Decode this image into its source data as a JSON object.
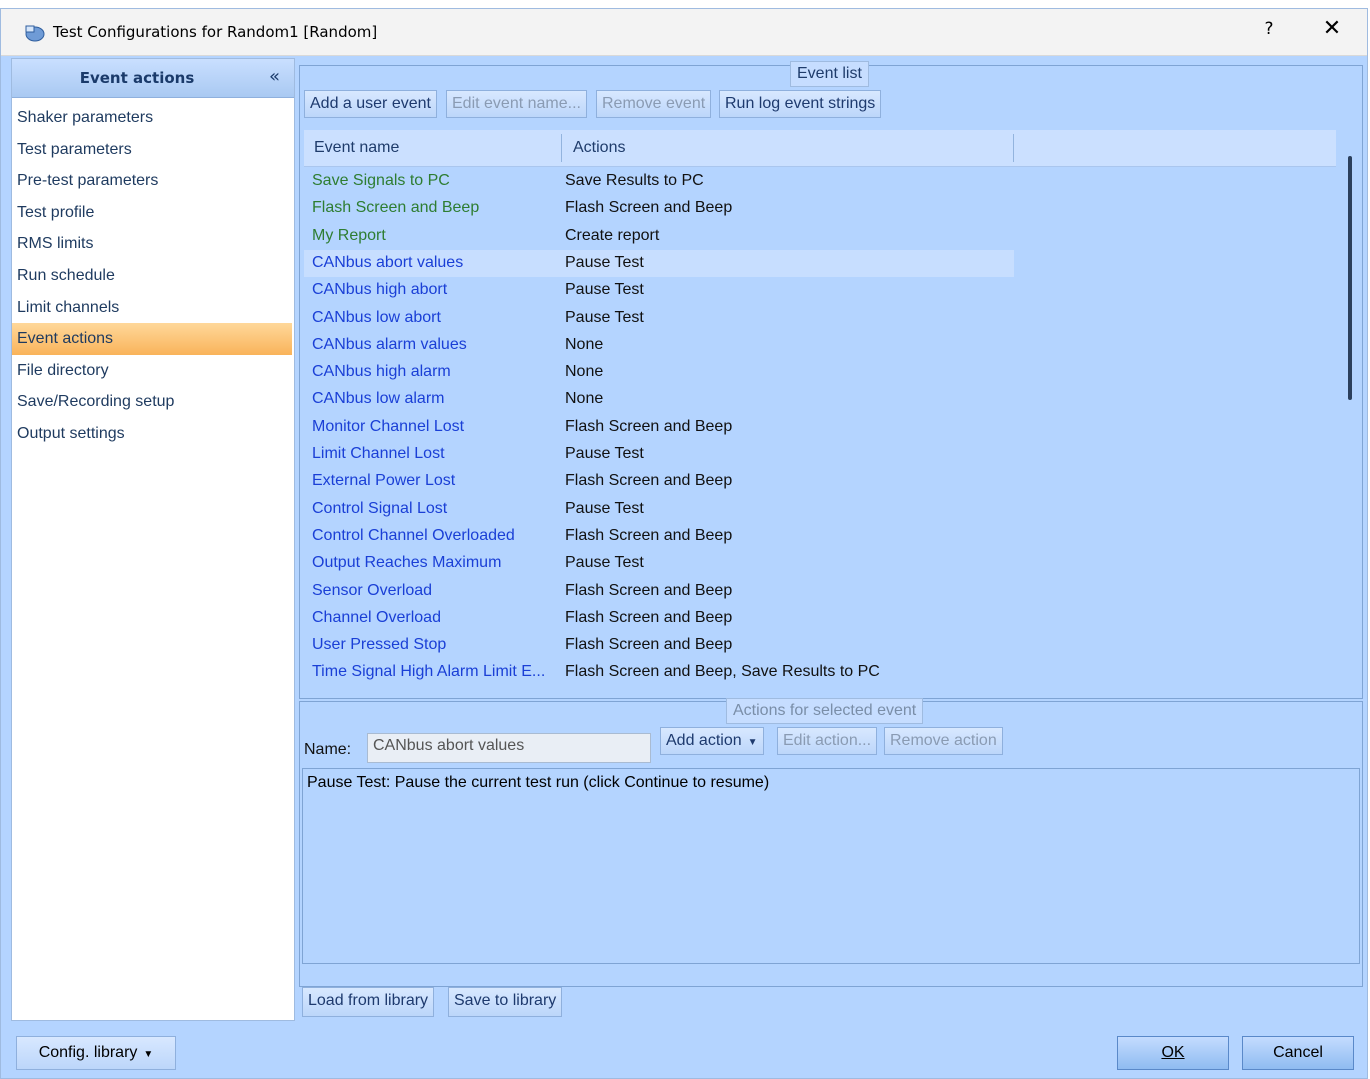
{
  "window": {
    "title": "Test Configurations for Random1 [Random]",
    "help_label": "?",
    "close_label": "✕"
  },
  "nav": {
    "header": "Event actions",
    "collapse_label": "«",
    "items": [
      {
        "label": "Shaker parameters"
      },
      {
        "label": "Test parameters"
      },
      {
        "label": "Pre-test parameters"
      },
      {
        "label": "Test profile"
      },
      {
        "label": "RMS limits"
      },
      {
        "label": "Run schedule"
      },
      {
        "label": "Limit channels"
      },
      {
        "label": "Event actions",
        "active": true
      },
      {
        "label": "File directory"
      },
      {
        "label": "Save/Recording setup"
      },
      {
        "label": "Output settings"
      }
    ]
  },
  "event_list": {
    "caption": "Event list",
    "buttons": {
      "add": "Add a user event",
      "edit": "Edit event name...",
      "remove": "Remove event",
      "run_log": "Run log event strings"
    },
    "columns": {
      "name": "Event name",
      "actions": "Actions"
    },
    "rows": [
      {
        "name": "Save Signals to PC",
        "action": "Save Results to PC",
        "kind": "user"
      },
      {
        "name": "Flash Screen and Beep",
        "action": "Flash Screen and Beep",
        "kind": "user"
      },
      {
        "name": "My Report",
        "action": "Create report",
        "kind": "user"
      },
      {
        "name": "CANbus abort values",
        "action": "Pause Test",
        "kind": "system",
        "selected": true
      },
      {
        "name": "CANbus high abort",
        "action": "Pause Test",
        "kind": "system"
      },
      {
        "name": "CANbus low abort",
        "action": "Pause Test",
        "kind": "system"
      },
      {
        "name": "CANbus alarm values",
        "action": "None",
        "kind": "system"
      },
      {
        "name": "CANbus high alarm",
        "action": "None",
        "kind": "system"
      },
      {
        "name": "CANbus low alarm",
        "action": "None",
        "kind": "system"
      },
      {
        "name": "Monitor Channel Lost",
        "action": "Flash Screen and Beep",
        "kind": "system"
      },
      {
        "name": "Limit Channel Lost",
        "action": "Pause Test",
        "kind": "system"
      },
      {
        "name": "External Power Lost",
        "action": "Flash Screen and Beep",
        "kind": "system"
      },
      {
        "name": "Control Signal Lost",
        "action": "Pause Test",
        "kind": "system"
      },
      {
        "name": "Control Channel Overloaded",
        "action": "Flash Screen and Beep",
        "kind": "system"
      },
      {
        "name": "Output Reaches Maximum",
        "action": "Pause Test",
        "kind": "system"
      },
      {
        "name": "Sensor Overload",
        "action": "Flash Screen and Beep",
        "kind": "system"
      },
      {
        "name": "Channel Overload",
        "action": "Flash Screen and Beep",
        "kind": "system"
      },
      {
        "name": "User Pressed Stop",
        "action": "Flash Screen and Beep",
        "kind": "system"
      },
      {
        "name": "Time Signal High Alarm Limit E...",
        "action": "Flash Screen and Beep, Save Results to PC",
        "kind": "system"
      }
    ]
  },
  "selected_event": {
    "caption": "Actions for selected event",
    "name_label": "Name:",
    "name_value": "CANbus abort values",
    "buttons": {
      "add": "Add action",
      "edit": "Edit action...",
      "remove": "Remove action"
    },
    "description": "Pause Test: Pause the current test run (click Continue to resume)"
  },
  "library": {
    "load": "Load from library",
    "save": "Save to library"
  },
  "footer": {
    "config_library": "Config. library",
    "ok": "OK",
    "cancel": "Cancel"
  },
  "colors": {
    "user_event": "#2e7d32",
    "system_event": "#1a3fd6",
    "active_nav": "#f9b35a",
    "panel_bg": "#b4d4ff"
  }
}
